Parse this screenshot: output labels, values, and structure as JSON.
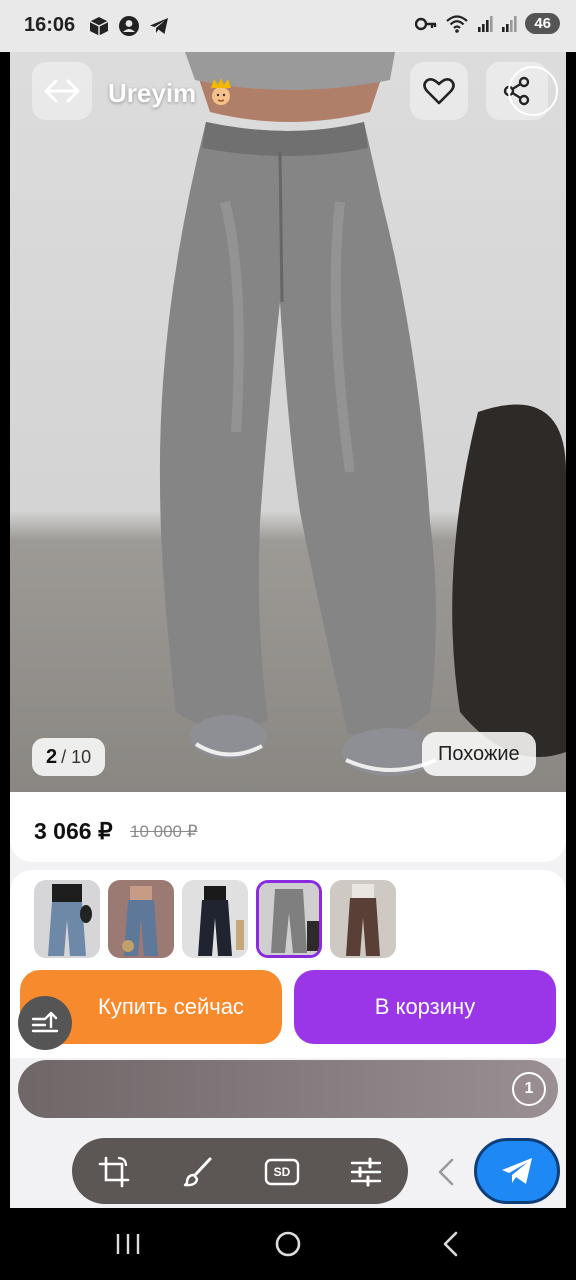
{
  "status_bar": {
    "time": "16:06",
    "battery": "46",
    "left_icons": [
      "box-icon",
      "account-icon",
      "telegram-icon"
    ],
    "right_icons": [
      "key-icon",
      "wifi-icon",
      "signal-icon",
      "signal-icon"
    ]
  },
  "header": {
    "shop_name": "Ureyim",
    "shop_badge_icon": "crown-emoji-icon",
    "back_icon": "back-arrow-icon",
    "favorite_icon": "heart-icon",
    "share_icon": "share-icon"
  },
  "gallery": {
    "current": "2",
    "total": "/ 10",
    "similar_label": "Похожие"
  },
  "price": {
    "current": "3 066 ₽",
    "old": "10 000 ₽"
  },
  "thumbnails": [
    {
      "selected": false
    },
    {
      "selected": false
    },
    {
      "selected": false
    },
    {
      "selected": true
    },
    {
      "selected": false
    }
  ],
  "actions": {
    "buy_now": "Купить сейчас",
    "add_to_cart": "В корзину",
    "sort_icon": "sort-icon"
  },
  "info_bar": {
    "timer_value": "1"
  },
  "browser_tools": {
    "icons": [
      "crop-rotate-icon",
      "brush-icon",
      "sd-icon",
      "sliders-icon"
    ],
    "sd_label": "SD",
    "collapse_icon": "chevron-left-icon",
    "send_icon": "send-icon"
  },
  "navbar": {
    "icons": [
      "recents-icon",
      "home-icon",
      "back-icon"
    ]
  },
  "colors": {
    "buy_button": "#f88a2e",
    "cart_button": "#9b36e8",
    "send_button": "#1e88f5",
    "selected_thumb_border": "#8b2be0"
  }
}
